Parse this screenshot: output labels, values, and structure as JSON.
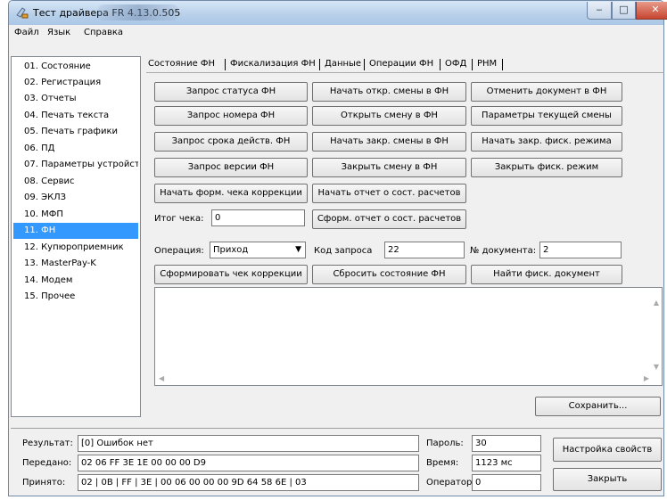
{
  "window": {
    "title": "Тест драйвера FR 4.13.0.505",
    "min_glyph": "‒",
    "max_glyph": "□",
    "close_glyph": "✕"
  },
  "menu": [
    "Файл",
    "Язык",
    "Справка"
  ],
  "sidebar": {
    "items": [
      "01. Состояние",
      "02. Регистрация",
      "03. Отчеты",
      "04. Печать текста",
      "05. Печать графики",
      "06. ПД",
      "07. Параметры устройства",
      "08. Сервис",
      "09. ЭКЛЗ",
      "10. МФП",
      "11. ФН",
      "12. Купюроприемник",
      "13. MasterPay-K",
      "14. Модем",
      "15. Прочее"
    ],
    "selected_index": 10
  },
  "tabs": [
    "Состояние ФН",
    "Фискализация ФН",
    "Данные",
    "Операции ФН",
    "ОФД",
    "РНМ"
  ],
  "buttons": {
    "r1c1": "Запрос статуса ФН",
    "r1c2": "Начать откр. смены в ФН",
    "r1c3": "Отменить документ в ФН",
    "r2c1": "Запрос номера ФН",
    "r2c2": "Открыть смену в ФН",
    "r2c3": "Параметры текущей смены",
    "r3c1": "Запрос срока действ. ФН",
    "r3c2": "Начать закр. смены в ФН",
    "r3c3": "Начать закр. фиск. режима",
    "r4c1": "Запрос версии ФН",
    "r4c2": "Закрыть смену в ФН",
    "r4c3": "Закрыть фиск. режим",
    "r5c1": "Начать форм. чека коррекции",
    "r5c2": "Начать отчет о сост. расчетов",
    "r6c2": "Сформ. отчет о сост. расчетов",
    "r8c1": "Сформировать чек коррекции",
    "r8c2": "Сбросить состояние ФН",
    "r8c3": "Найти фиск. документ",
    "save": "Сохранить...",
    "settings": "Настройка свойств",
    "close": "Закрыть"
  },
  "fields": {
    "receipt_total_label": "Итог чека:",
    "receipt_total_value": "0",
    "operation_label": "Операция:",
    "operation_value": "Приход",
    "request_code_label": "Код запроса",
    "request_code_value": "22",
    "doc_number_label": "№ документа:",
    "doc_number_value": "2"
  },
  "status": {
    "result_label": "Результат:",
    "result_value": "[0] Ошибок нет",
    "sent_label": "Передано:",
    "sent_value": "02 06 FF 3E 1E 00 00 00 D9",
    "received_label": "Принято:",
    "received_value": "02 | 0B | FF | 3E | 00 06 00 00 00 9D 64 58 6E | 03",
    "password_label": "Пароль:",
    "password_value": "30",
    "time_label": "Время:",
    "time_value": "1123 мс",
    "operator_label": "Оператор:",
    "operator_value": "0"
  }
}
